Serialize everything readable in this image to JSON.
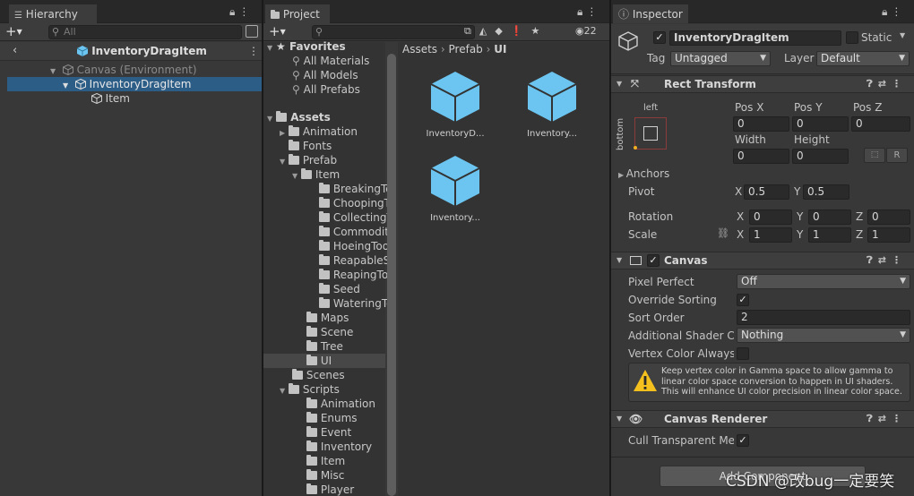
{
  "hierarchy": {
    "tab": "Hierarchy",
    "search_placeholder": "All",
    "scene_title": "InventoryDragItem",
    "items": [
      {
        "label": "Canvas (Environment)"
      },
      {
        "label": "InventoryDragItem"
      },
      {
        "label": "Item"
      }
    ]
  },
  "project": {
    "tab": "Project",
    "filter_count": "22",
    "favorites_label": "Favorites",
    "favorites": [
      "All Materials",
      "All Models",
      "All Prefabs"
    ],
    "assets_label": "Assets",
    "tree": [
      {
        "label": "Animation"
      },
      {
        "label": "Fonts"
      },
      {
        "label": "Prefab"
      },
      {
        "label": "Item"
      },
      {
        "label": "BreakingTo"
      },
      {
        "label": "ChoopingT"
      },
      {
        "label": "CollectingT"
      },
      {
        "label": "Commodity"
      },
      {
        "label": "HoeingToo"
      },
      {
        "label": "ReapableS"
      },
      {
        "label": "ReapingTo"
      },
      {
        "label": "Seed"
      },
      {
        "label": "WateringTo"
      },
      {
        "label": "Maps"
      },
      {
        "label": "Scene"
      },
      {
        "label": "Tree"
      },
      {
        "label": "UI"
      },
      {
        "label": "Scenes"
      },
      {
        "label": "Scripts"
      },
      {
        "label": "Animation"
      },
      {
        "label": "Enums"
      },
      {
        "label": "Event"
      },
      {
        "label": "Inventory"
      },
      {
        "label": "Item"
      },
      {
        "label": "Misc"
      },
      {
        "label": "Player"
      }
    ],
    "breadcrumb": [
      "Assets",
      "Prefab",
      "UI"
    ],
    "grid_items": [
      "InventoryD...",
      "Inventory...",
      "Inventory..."
    ]
  },
  "inspector": {
    "tab": "Inspector",
    "object_name": "InventoryDragItem",
    "static_label": "Static",
    "tag_label": "Tag",
    "tag_value": "Untagged",
    "layer_label": "Layer",
    "layer_value": "Default",
    "rect_transform": {
      "title": "Rect Transform",
      "anchor_left": "left",
      "anchor_bottom": "bottom",
      "pos_x_label": "Pos X",
      "pos_y_label": "Pos Y",
      "pos_z_label": "Pos Z",
      "pos_x": "0",
      "pos_y": "0",
      "pos_z": "0",
      "width_label": "Width",
      "height_label": "Height",
      "width": "0",
      "height": "0",
      "r_button": "R",
      "anchors_label": "Anchors",
      "pivot_label": "Pivot",
      "x_label": "X",
      "y_label": "Y",
      "z_label": "Z",
      "pivot_x": "0.5",
      "pivot_y": "0.5",
      "rotation_label": "Rotation",
      "rot_x": "0",
      "rot_y": "0",
      "rot_z": "0",
      "scale_label": "Scale",
      "scale_x": "1",
      "scale_y": "1",
      "scale_z": "1"
    },
    "canvas": {
      "title": "Canvas",
      "pixel_perfect_label": "Pixel Perfect",
      "pixel_perfect_value": "Off",
      "override_sorting_label": "Override Sorting",
      "sort_order_label": "Sort Order",
      "sort_order_value": "2",
      "shader_channels_label": "Additional Shader Ch",
      "shader_channels_value": "Nothing",
      "vertex_color_label": "Vertex Color Always I",
      "warning_text": "Keep vertex color in Gamma space to allow gamma to linear color space conversion to happen in UI shaders. This will enhance UI color precision in linear color space."
    },
    "canvas_renderer": {
      "title": "Canvas Renderer",
      "cull_label": "Cull Transparent Mes"
    },
    "add_component": "Add Component",
    "watermark": "CSDN @改bug一定要笑"
  },
  "colors": {
    "selection": "#2c5d87",
    "cube": "#6bc5f0",
    "warning": "#f4c01e"
  }
}
